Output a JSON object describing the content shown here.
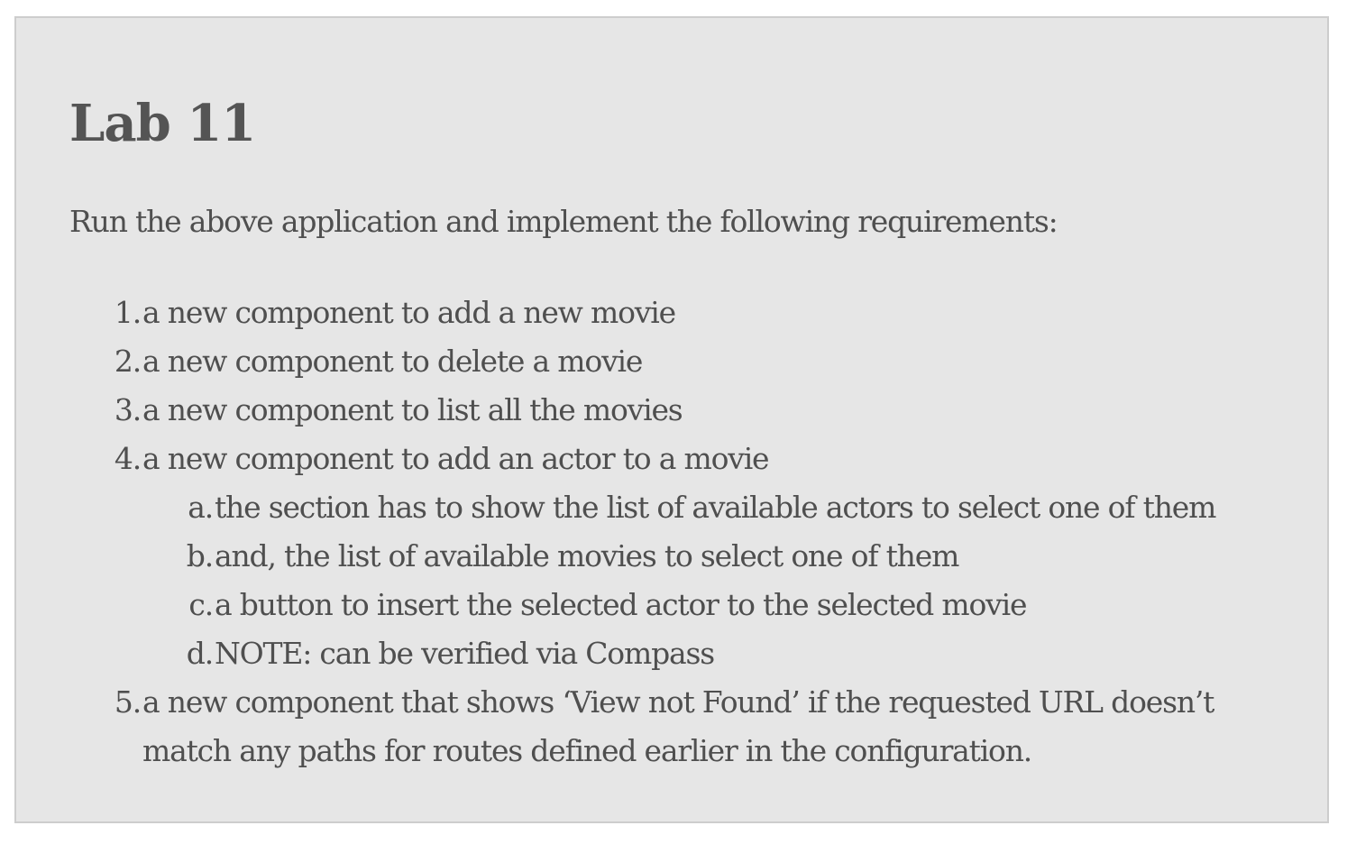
{
  "title": "Lab 11",
  "intro": "Run the above application and implement the following requirements:",
  "requirements": [
    {
      "marker": "1.",
      "text": "a new component to add a new movie"
    },
    {
      "marker": "2.",
      "text": "a new component to delete a movie"
    },
    {
      "marker": "3.",
      "text": "a new component to list all the movies"
    },
    {
      "marker": "4.",
      "text": "a new component to add an actor to a movie",
      "subitems": [
        {
          "marker": "a.",
          "text": "the section has to show the list of available actors to select one of them"
        },
        {
          "marker": "b.",
          "text": "and, the list of available movies to select one of them"
        },
        {
          "marker": "c.",
          "text": "a button to insert the selected actor to the selected movie"
        },
        {
          "marker": "d.",
          "text": "NOTE: can be verified via Compass"
        }
      ]
    },
    {
      "marker": "5.",
      "text_line1": "a new component that shows ‘View not Found’ if the requested URL doesn’t",
      "text_line2": "match any paths for routes defined earlier in the configuration."
    }
  ],
  "colors": {
    "background": "#e6e6e6",
    "border": "#cdcdcd",
    "text": "#4f4f4f",
    "title": "#545454"
  }
}
